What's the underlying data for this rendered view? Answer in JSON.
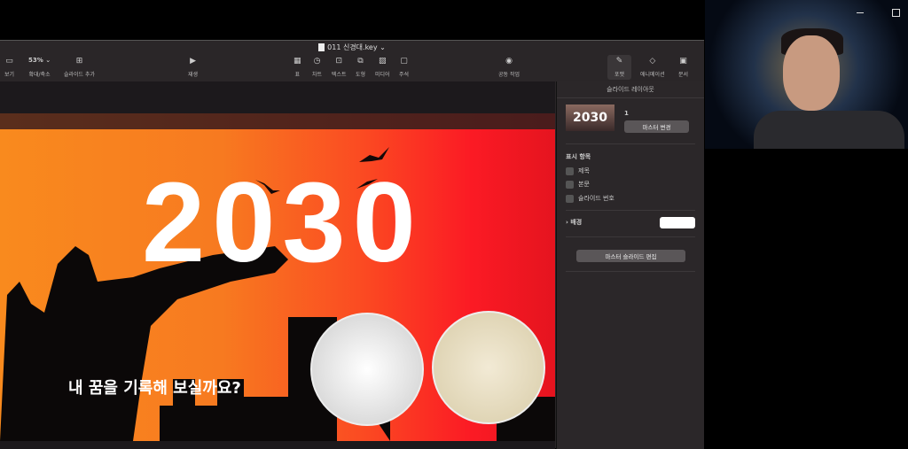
{
  "window": {
    "title": "011 신경대.key"
  },
  "toolbar": {
    "view": "보기",
    "zoom_value": "53%",
    "zoom": "확대/축소",
    "add_slide": "슬라이드 추가",
    "play": "재생",
    "table": "표",
    "chart": "차트",
    "text": "텍스트",
    "shape": "도형",
    "media": "미디어",
    "comment": "주석",
    "collaborate": "공동 작업",
    "format": "포맷",
    "animate": "애니메이션",
    "document": "문서"
  },
  "slide": {
    "title": "2030",
    "subtitle": "내 꿈을 기록해 보실까요?"
  },
  "sidebar": {
    "header": "슬라이드 레이아웃",
    "thumb_text": "2030",
    "master_num": "1",
    "change_master": "마스터 변경",
    "display_items": "표시 항목",
    "items": [
      "제목",
      "본문",
      "슬라이드 번호"
    ],
    "background": "배경",
    "edit_master": "마스터 슬라이드 편집"
  }
}
